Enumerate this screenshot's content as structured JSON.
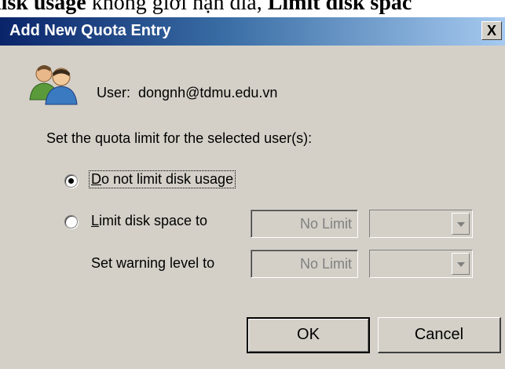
{
  "doc_strip": {
    "bold_1": "disk usage",
    "normal": " không giới hạn đĩa, ",
    "bold_2": "Limit disk spac"
  },
  "dialog": {
    "title": "Add New Quota Entry",
    "close_glyph": "X",
    "user_label": "User:",
    "user_value": "dongnh@tdmu.edu.vn",
    "instruction": "Set the quota limit for the selected user(s):",
    "option_no_limit": {
      "label_ul": "D",
      "label_rest": "o not limit disk usage",
      "selected": true
    },
    "option_limit": {
      "label_ul": "L",
      "label_rest": "imit disk space to",
      "selected": false
    },
    "disk_space_value": "No Limit",
    "warning_label": "Set warning level to",
    "warning_value": "No Limit",
    "ok_label": "OK",
    "cancel_label": "Cancel"
  },
  "icons": {
    "users": "users-icon",
    "close": "close-icon",
    "dropdown": "chevron-down-icon"
  },
  "colors": {
    "dialog_bg": "#d4d0c8",
    "title_start": "#0a246a",
    "title_end": "#a6caf0"
  }
}
